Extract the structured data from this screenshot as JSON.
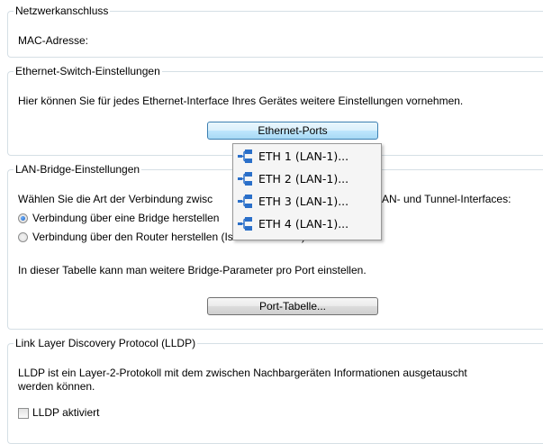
{
  "netzwerk": {
    "legend": "Netzwerkanschluss",
    "mac_label": "MAC-Adresse:"
  },
  "ethernet_switch": {
    "legend": "Ethernet-Switch-Einstellungen",
    "description": "Hier können Sie für jedes Ethernet-Interface Ihres Gerätes weitere Einstellungen vornehmen.",
    "button_label": "Ethernet-Ports"
  },
  "lan_bridge": {
    "legend": "LAN-Bridge-Einstellungen",
    "description_left": "Wählen Sie die Art der Verbindung zwisc",
    "description_right": "AN- und Tunnel-Interfaces:",
    "radio_bridge_label": "Verbindung über eine Bridge herstellen",
    "radio_bridge_checked": true,
    "radio_router_label": "Verbindung über den Router herstellen (Isolierter Modus)",
    "radio_router_checked": false,
    "table_description": "In dieser Tabelle kann man weitere Bridge-Parameter pro Port einstellen.",
    "port_table_button": "Port-Tabelle..."
  },
  "lldp": {
    "legend": "Link Layer Discovery Protocol (LLDP)",
    "description_line1": "LLDP ist ein Layer-2-Protokoll mit dem zwischen Nachbargeräten Informationen ausgetauscht",
    "description_line2": "werden können.",
    "checkbox_label": "LLDP aktiviert",
    "checkbox_checked": false
  },
  "ports_menu": {
    "items": [
      {
        "label": "ETH 1 (LAN-1)...",
        "icon": "network-port-icon"
      },
      {
        "label": "ETH 2 (LAN-1)...",
        "icon": "network-port-icon"
      },
      {
        "label": "ETH 3 (LAN-1)...",
        "icon": "network-port-icon"
      },
      {
        "label": "ETH 4 (LAN-1)...",
        "icon": "network-port-icon"
      }
    ]
  },
  "colors": {
    "group_border": "#d5dfe5",
    "button_active_border": "#3c7fb1",
    "radio_dot": "#1c5ebb",
    "network_icon": "#2a6fc9"
  }
}
